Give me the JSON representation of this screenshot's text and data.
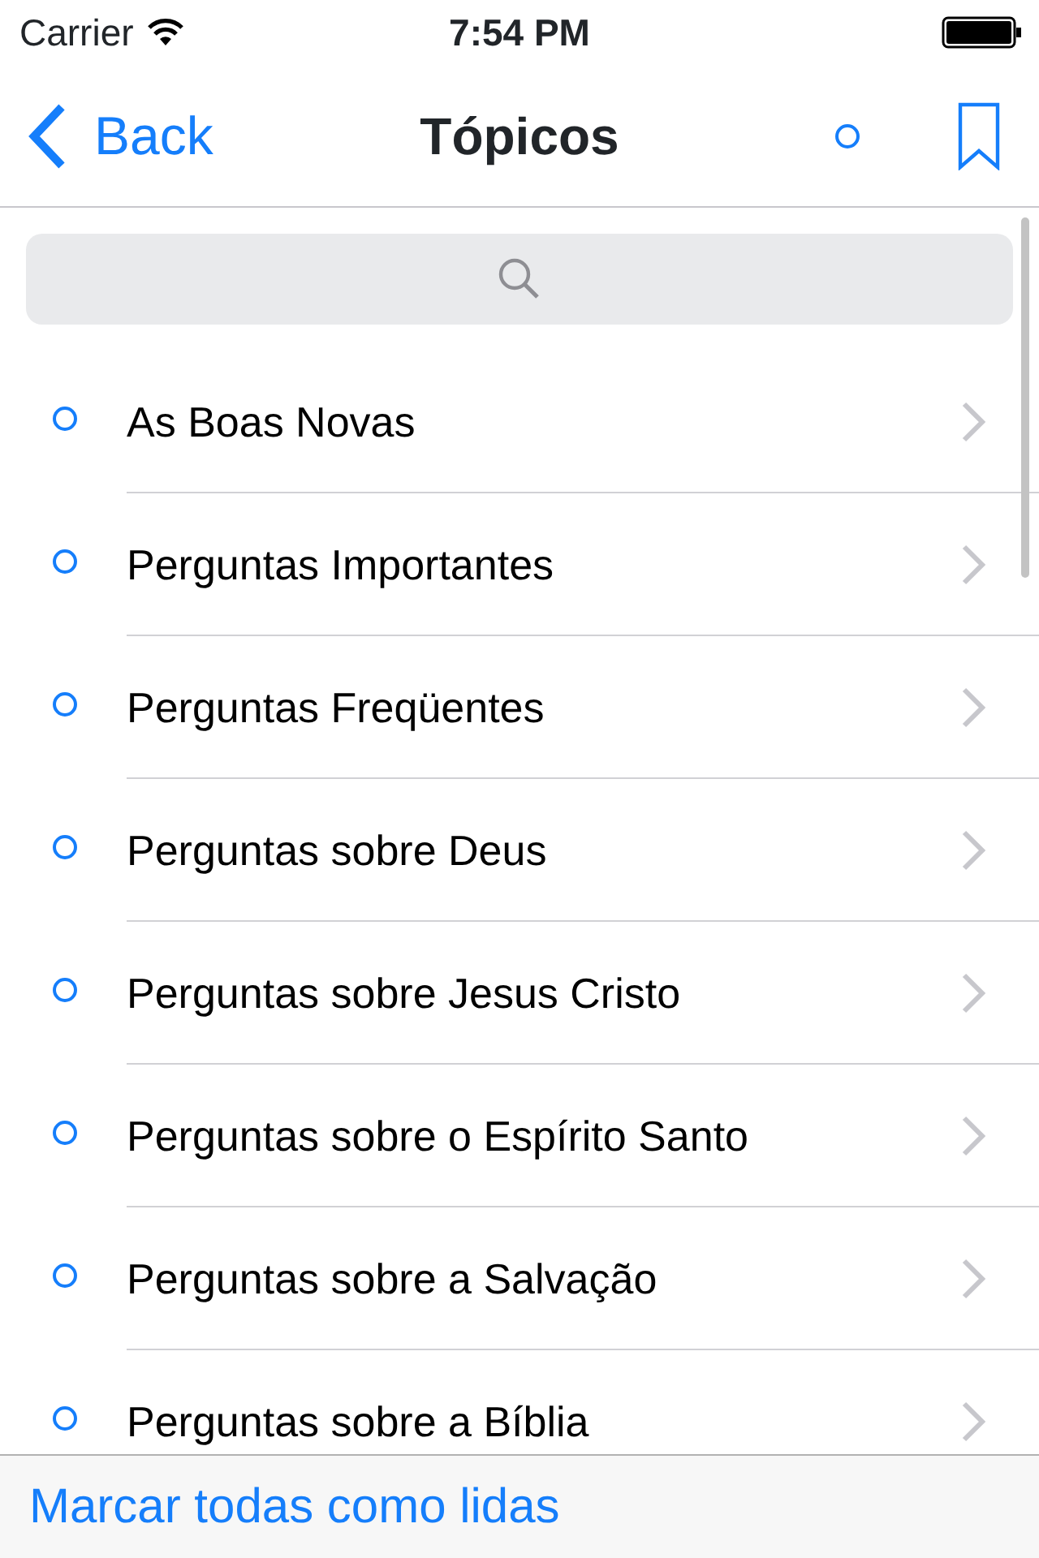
{
  "status_bar": {
    "carrier": "Carrier",
    "time": "7:54 PM"
  },
  "nav_bar": {
    "back": "Back",
    "title": "Tópicos",
    "unread_dot": true
  },
  "topics": [
    {
      "label": "As Boas Novas",
      "unread": true
    },
    {
      "label": "Perguntas Importantes",
      "unread": true
    },
    {
      "label": "Perguntas Freqüentes",
      "unread": true
    },
    {
      "label": "Perguntas sobre Deus",
      "unread": true
    },
    {
      "label": "Perguntas sobre Jesus Cristo",
      "unread": true
    },
    {
      "label": "Perguntas sobre o Espírito Santo",
      "unread": true
    },
    {
      "label": "Perguntas sobre a Salvação",
      "unread": true
    },
    {
      "label": "Perguntas sobre a Bíblia",
      "unread": true
    }
  ],
  "toolbar": {
    "action": "Marcar todas como lidas"
  }
}
